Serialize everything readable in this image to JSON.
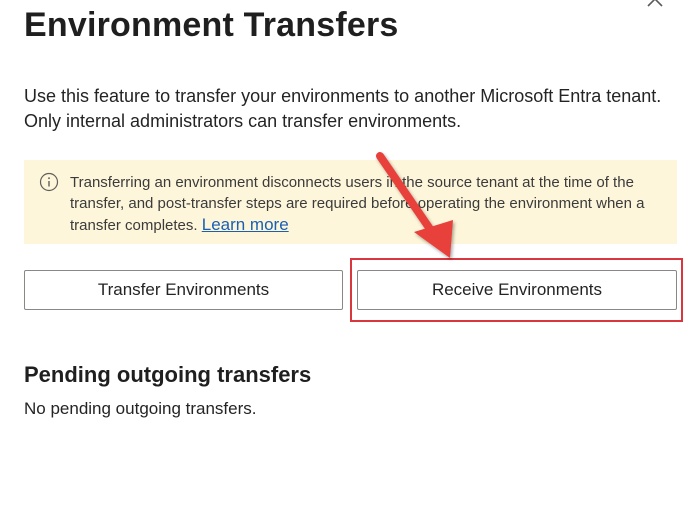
{
  "panel": {
    "title": "Environment Transfers",
    "description": "Use this feature to transfer your environments to another Microsoft Entra tenant. Only internal administrators can transfer environments."
  },
  "warning": {
    "icon": "info-icon",
    "text": "Transferring an environment disconnects users in the source tenant at the time of the transfer, and post-transfer steps are required before operating the environment when a transfer completes.",
    "link_label": "Learn more"
  },
  "actions": {
    "transfer_label": "Transfer Environments",
    "receive_label": "Receive Environments"
  },
  "pending": {
    "title": "Pending outgoing transfers",
    "empty_text": "No pending outgoing transfers."
  },
  "annotation": {
    "highlight_color": "#d9363e",
    "arrow_color": "#e8403a"
  },
  "colors": {
    "warning_bg": "#fdf6da",
    "link": "#1a5fb4"
  }
}
